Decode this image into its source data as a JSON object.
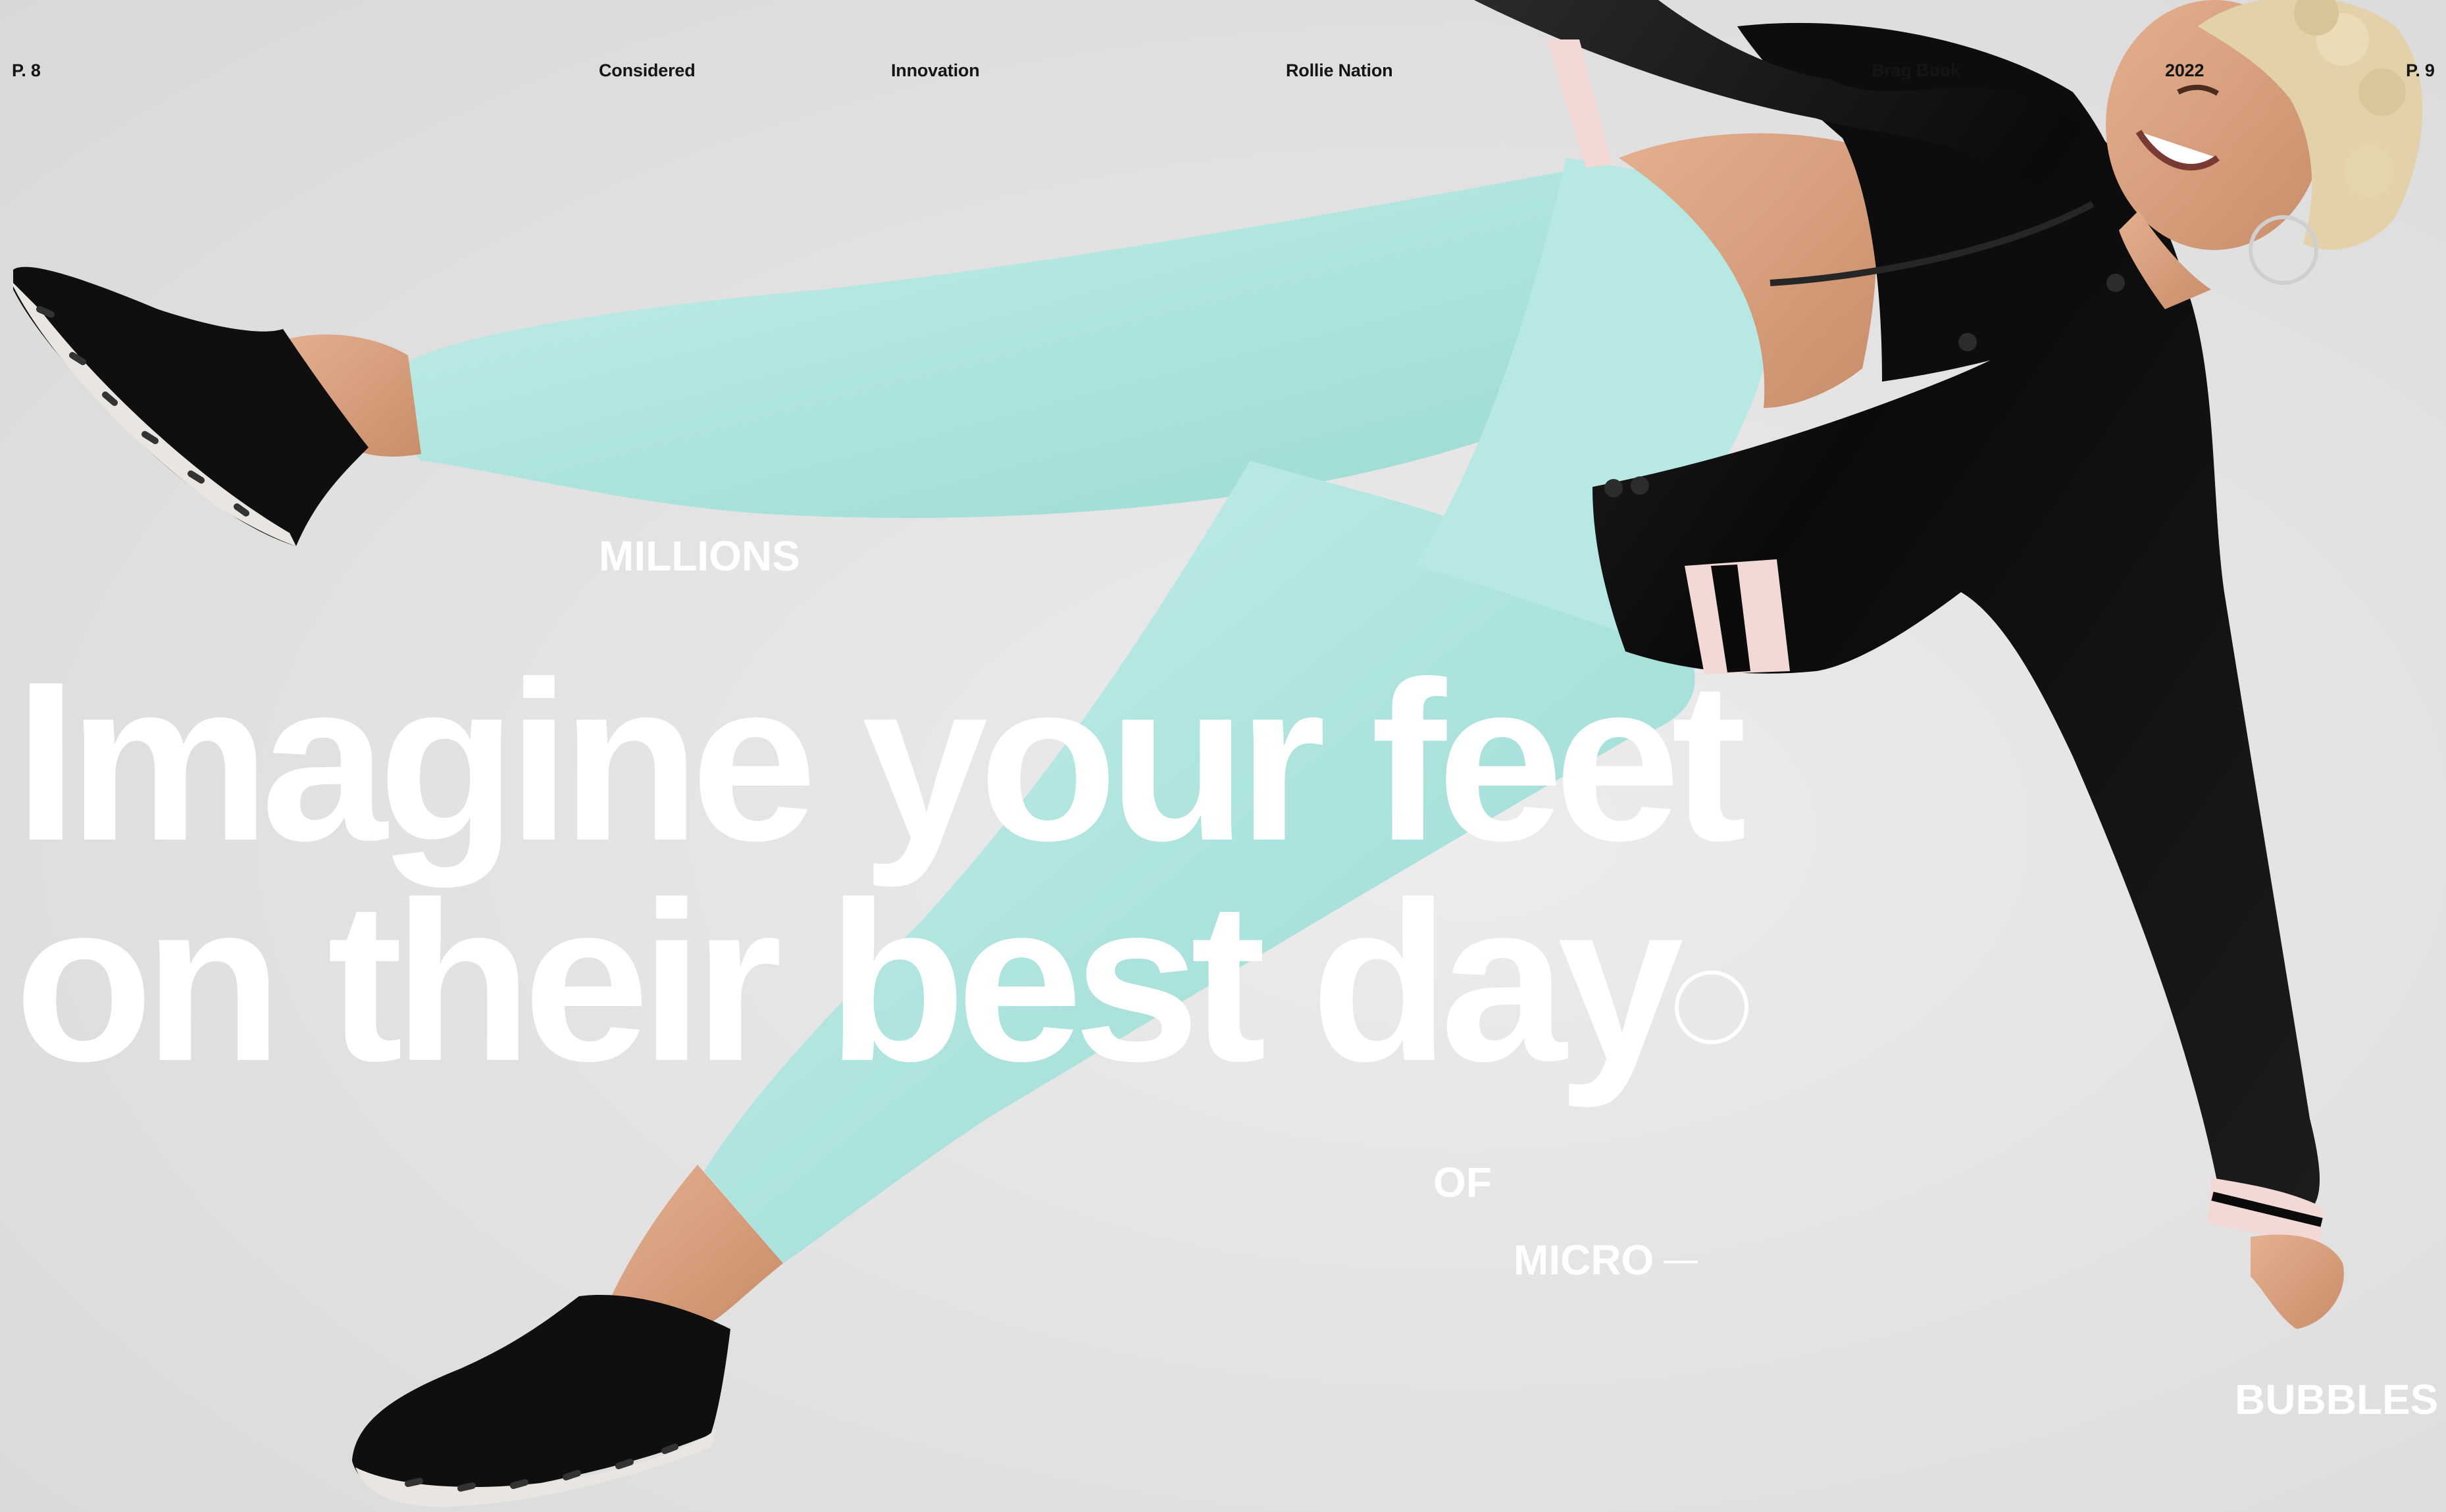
{
  "header": {
    "page_left": "P. 8",
    "section_1": "Considered",
    "section_2": "Innovation",
    "section_3": "Rollie Nation",
    "section_4": "Brag Book",
    "year": "2022",
    "page_right": "P. 9"
  },
  "headline": {
    "line_1": "Imagine your feet",
    "line_2": "on their best day"
  },
  "callouts": {
    "millions": "MILLIONS",
    "of": "OF",
    "micro": "MICRO",
    "bubbles": "BUBBLES"
  },
  "colors": {
    "background": "#e4e3e3",
    "pants": "#aee4df",
    "jacket": "#0c0c0c",
    "headline_text": "#ffffff",
    "header_text": "#151515"
  }
}
